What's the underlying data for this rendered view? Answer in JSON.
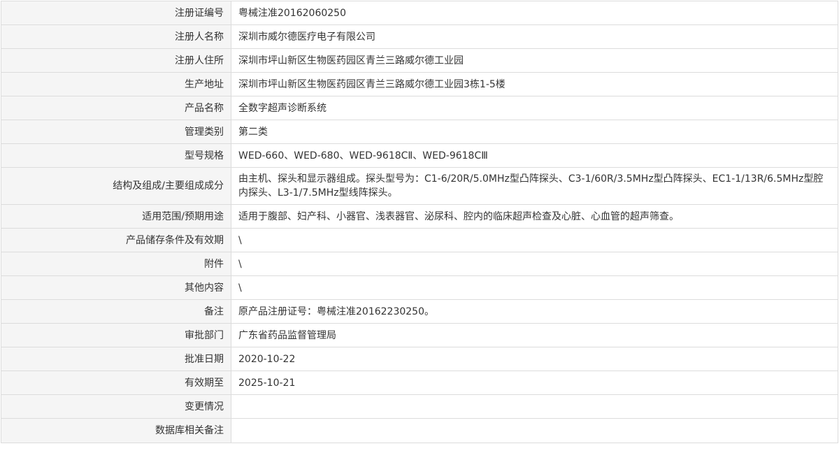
{
  "rows": [
    {
      "label": "注册证编号",
      "value": "粤械注准20162060250"
    },
    {
      "label": "注册人名称",
      "value": "深圳市威尔德医疗电子有限公司"
    },
    {
      "label": "注册人住所",
      "value": "深圳市坪山新区生物医药园区青兰三路威尔德工业园"
    },
    {
      "label": "生产地址",
      "value": "深圳市坪山新区生物医药园区青兰三路威尔德工业园3栋1-5楼"
    },
    {
      "label": "产品名称",
      "value": "全数字超声诊断系统"
    },
    {
      "label": "管理类别",
      "value": "第二类"
    },
    {
      "label": "型号规格",
      "value": "WED-660、WED-680、WED-9618CⅡ、WED-9618CⅢ"
    },
    {
      "label": "结构及组成/主要组成成分",
      "value": "由主机、探头和显示器组成。探头型号为：C1-6/20R/5.0MHz型凸阵探头、C3-1/60R/3.5MHz型凸阵探头、EC1-1/13R/6.5MHz型腔内探头、L3-1/7.5MHz型线阵探头。"
    },
    {
      "label": "适用范围/预期用途",
      "value": "适用于腹部、妇产科、小器官、浅表器官、泌尿科、腔内的临床超声检查及心脏、心血管的超声筛查。"
    },
    {
      "label": "产品储存条件及有效期",
      "value": "\\"
    },
    {
      "label": "附件",
      "value": "\\"
    },
    {
      "label": "其他内容",
      "value": "\\"
    },
    {
      "label": "备注",
      "value": "原产品注册证号：粤械注准20162230250。"
    },
    {
      "label": "审批部门",
      "value": "广东省药品监督管理局"
    },
    {
      "label": "批准日期",
      "value": "2020-10-22"
    },
    {
      "label": "有效期至",
      "value": "2025-10-21"
    },
    {
      "label": "变更情况",
      "value": ""
    },
    {
      "label": "数据库相关备注",
      "value": ""
    }
  ]
}
